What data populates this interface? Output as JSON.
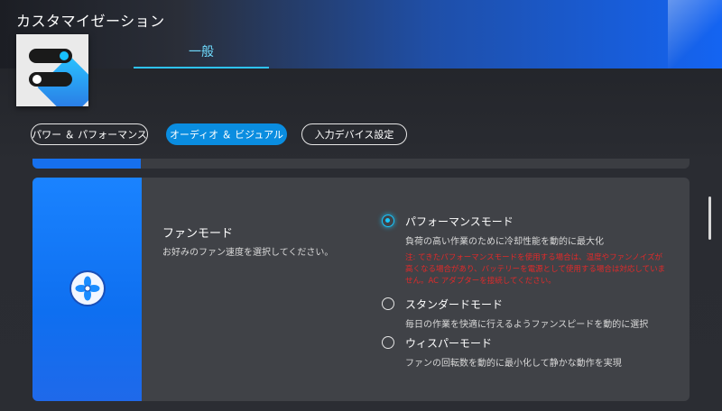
{
  "app": {
    "title": "カスタマイゼーション"
  },
  "top_tabs": [
    {
      "label": "一般",
      "selected": true
    }
  ],
  "pills": [
    {
      "label": "パワー ＆ パフォーマンス",
      "active": false
    },
    {
      "label": "オーディオ ＆ ビジュアル",
      "active": true
    },
    {
      "label": "入力デバイス設定",
      "active": false
    }
  ],
  "fan_card": {
    "title": "ファンモード",
    "description": "お好みのファン速度を選択してください。",
    "icon": "fan-icon",
    "options": [
      {
        "label": "パフォーマンスモード",
        "description": "負荷の高い作業のために冷却性能を動的に最大化",
        "warning": "注: てきたパフォーマンスモードを使用する場合は、温度やファンノイズが高くなる場合があり、バッテリーを電源として使用する場合は対応していません。AC アダプターを接続してください。",
        "selected": true
      },
      {
        "label": "スタンダードモード",
        "description": "毎日の作業を快適に行えるようファンスピードを動的に選択",
        "selected": false
      },
      {
        "label": "ウィスパーモード",
        "description": "ファンの回転数を動的に最小化して静かな動作を実現",
        "selected": false
      }
    ]
  },
  "colors": {
    "accent": "#18c8ff",
    "brand_blue": "#0e6ff0",
    "warning": "#e02a2a"
  }
}
